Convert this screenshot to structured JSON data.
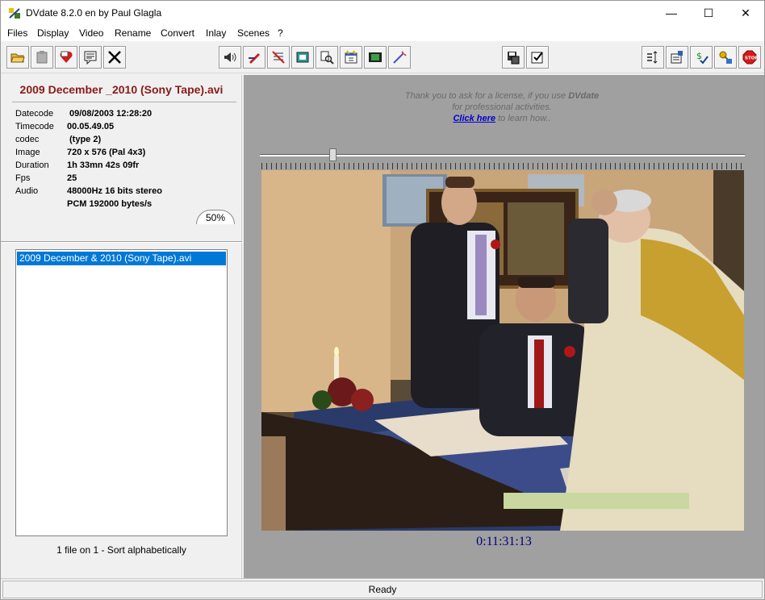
{
  "window": {
    "title": "DVdate 8.2.0 en by Paul Glagla",
    "minimize": "—",
    "maximize": "☐",
    "close": "✕"
  },
  "menu": [
    "Files",
    "Display",
    "Video",
    "Rename",
    "Convert",
    "Inlay",
    "Scenes",
    "?"
  ],
  "toolbar_icons": {
    "left": [
      "open-folder-icon",
      "paste-icon",
      "heart-icon",
      "comment-icon",
      "close-x-icon"
    ],
    "middle": [
      "speaker-icon",
      "edit-pencil-icon",
      "strikethrough-icon",
      "frame-icon",
      "search-icon",
      "calendar-icon",
      "film-icon",
      "magic-wand-icon"
    ],
    "center": [
      "save-disk-icon",
      "checkbox-icon"
    ],
    "right": [
      "list-arrows-icon",
      "properties-icon",
      "dollar-check-icon",
      "key-icon",
      "stop-icon"
    ]
  },
  "file_info": {
    "title": "2009 December _2010 (Sony Tape).avi",
    "rows": [
      {
        "label": "Datecode",
        "value": "09/08/2003 12:28:20"
      },
      {
        "label": "Timecode",
        "value": "00.05.49.05"
      },
      {
        "label": "codec",
        "value": " (type 2)"
      },
      {
        "label": "Image",
        "value": "720 x 576 (Pal 4x3)"
      },
      {
        "label": "Duration",
        "value": "1h 33mn 42s 09fr"
      },
      {
        "label": "Fps",
        "value": "25"
      },
      {
        "label": "Audio",
        "value": "48000Hz 16 bits  stereo"
      },
      {
        "label": "",
        "value": "PCM 192000 bytes/s"
      }
    ],
    "zoom": "50%"
  },
  "file_list": {
    "items": [
      "2009 December & 2010 (Sony Tape).avi"
    ],
    "status": "1 file on 1 - Sort alphabetically"
  },
  "license": {
    "line1_a": "Thank you to ask for a license, if you use ",
    "line1_b": "DVdate",
    "line2": "for professional activities.",
    "link": "Click here",
    "line3": " to learn how.."
  },
  "player": {
    "position_fraction": 0.15,
    "timecode": "0:11:31:13"
  },
  "status": {
    "text": "Ready"
  },
  "colors": {
    "accent": "#0078d7",
    "file_title": "#8b1a1a",
    "timecode": "#00007a",
    "link": "#0000cc"
  }
}
